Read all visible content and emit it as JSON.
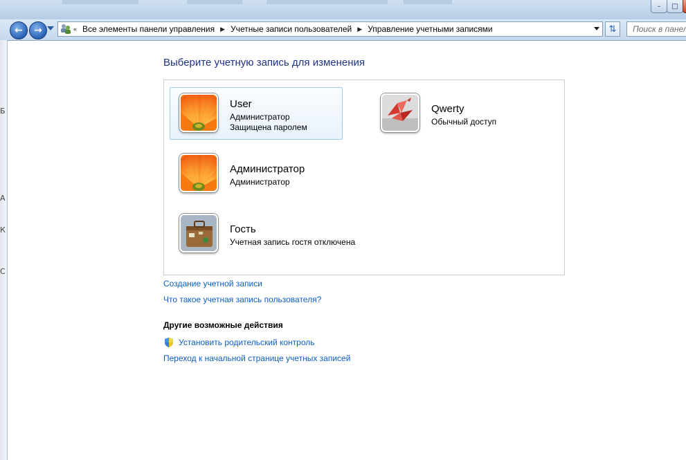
{
  "window": {
    "address_parts": [
      "Все элементы панели управления",
      "Учетные записи пользователей",
      "Управление учетными записями"
    ],
    "search_placeholder": "Поиск в панели"
  },
  "icons": {
    "back": "back-arrow-icon",
    "forward": "forward-arrow-icon",
    "history": "history-dropdown-icon",
    "address_location": "user-accounts-icon",
    "address_dropdown": "chevron-down-icon",
    "refresh": "refresh-icon",
    "shield": "uac-shield-icon",
    "minimize": "minimize-icon",
    "maximize": "maximize-icon",
    "close": "close-icon"
  },
  "main": {
    "heading": "Выберите учетную запись для изменения",
    "accounts": [
      {
        "name": "User",
        "lines": [
          "Администратор",
          "Защищена паролем"
        ],
        "picture": "orange-flower",
        "selected": true
      },
      {
        "name": "Qwerty",
        "lines": [
          "Обычный доступ"
        ],
        "picture": "origami-crane",
        "selected": false
      },
      {
        "name": "Администратор",
        "lines": [
          "Администратор"
        ],
        "picture": "orange-flower",
        "selected": false
      },
      {
        "name": "Гость",
        "lines": [
          "Учетная запись гостя отключена"
        ],
        "picture": "suitcase",
        "selected": false
      }
    ],
    "links": {
      "create": "Создание учетной записи",
      "what_is": "Что такое учетная запись пользователя?"
    },
    "other_actions": {
      "title": "Другие возможные действия",
      "parental_control": "Установить родительский контроль",
      "go_home": "Переход к начальной странице учетных записей"
    }
  },
  "colors": {
    "heading": "#1e3287",
    "link": "#0b5ec4",
    "selection_border": "#9ecbf4",
    "selection_fill": "#e9f2fc"
  }
}
